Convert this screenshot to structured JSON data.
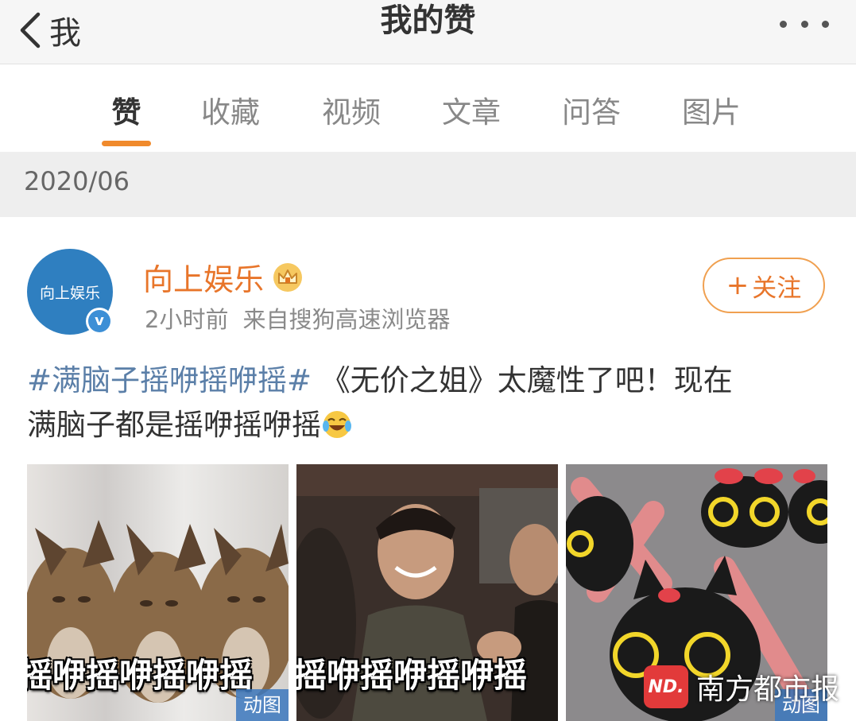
{
  "header": {
    "back_label": "我",
    "title": "我的赞"
  },
  "tabs": [
    {
      "label": "赞",
      "active": true
    },
    {
      "label": "收藏",
      "active": false
    },
    {
      "label": "视频",
      "active": false
    },
    {
      "label": "文章",
      "active": false
    },
    {
      "label": "问答",
      "active": false
    },
    {
      "label": "图片",
      "active": false
    }
  ],
  "month_label": "2020/06",
  "post": {
    "avatar_text": "向上娱乐",
    "author": "向上娱乐",
    "time": "2小时前",
    "source": "来自搜狗高速浏览器",
    "follow_label": "关注",
    "hashtag": "#满脑子摇咿摇咿摇#",
    "text_part1": "《无价之姐》太魔性了吧！现在",
    "text_part2": "满脑子都是摇咿摇咿摇",
    "images": [
      {
        "caption": "摇咿摇咿摇咿摇",
        "badge": "动图"
      },
      {
        "caption": "摇咿摇咿摇咿摇",
        "badge": ""
      },
      {
        "caption": "",
        "badge": "动图"
      }
    ]
  },
  "watermark": {
    "logo": "ND.",
    "text": "南方都市报"
  },
  "colors": {
    "accent": "#f08a2c",
    "author": "#e8752a",
    "hashtag": "#5b7fa8",
    "verified": "#3d8fd6"
  }
}
